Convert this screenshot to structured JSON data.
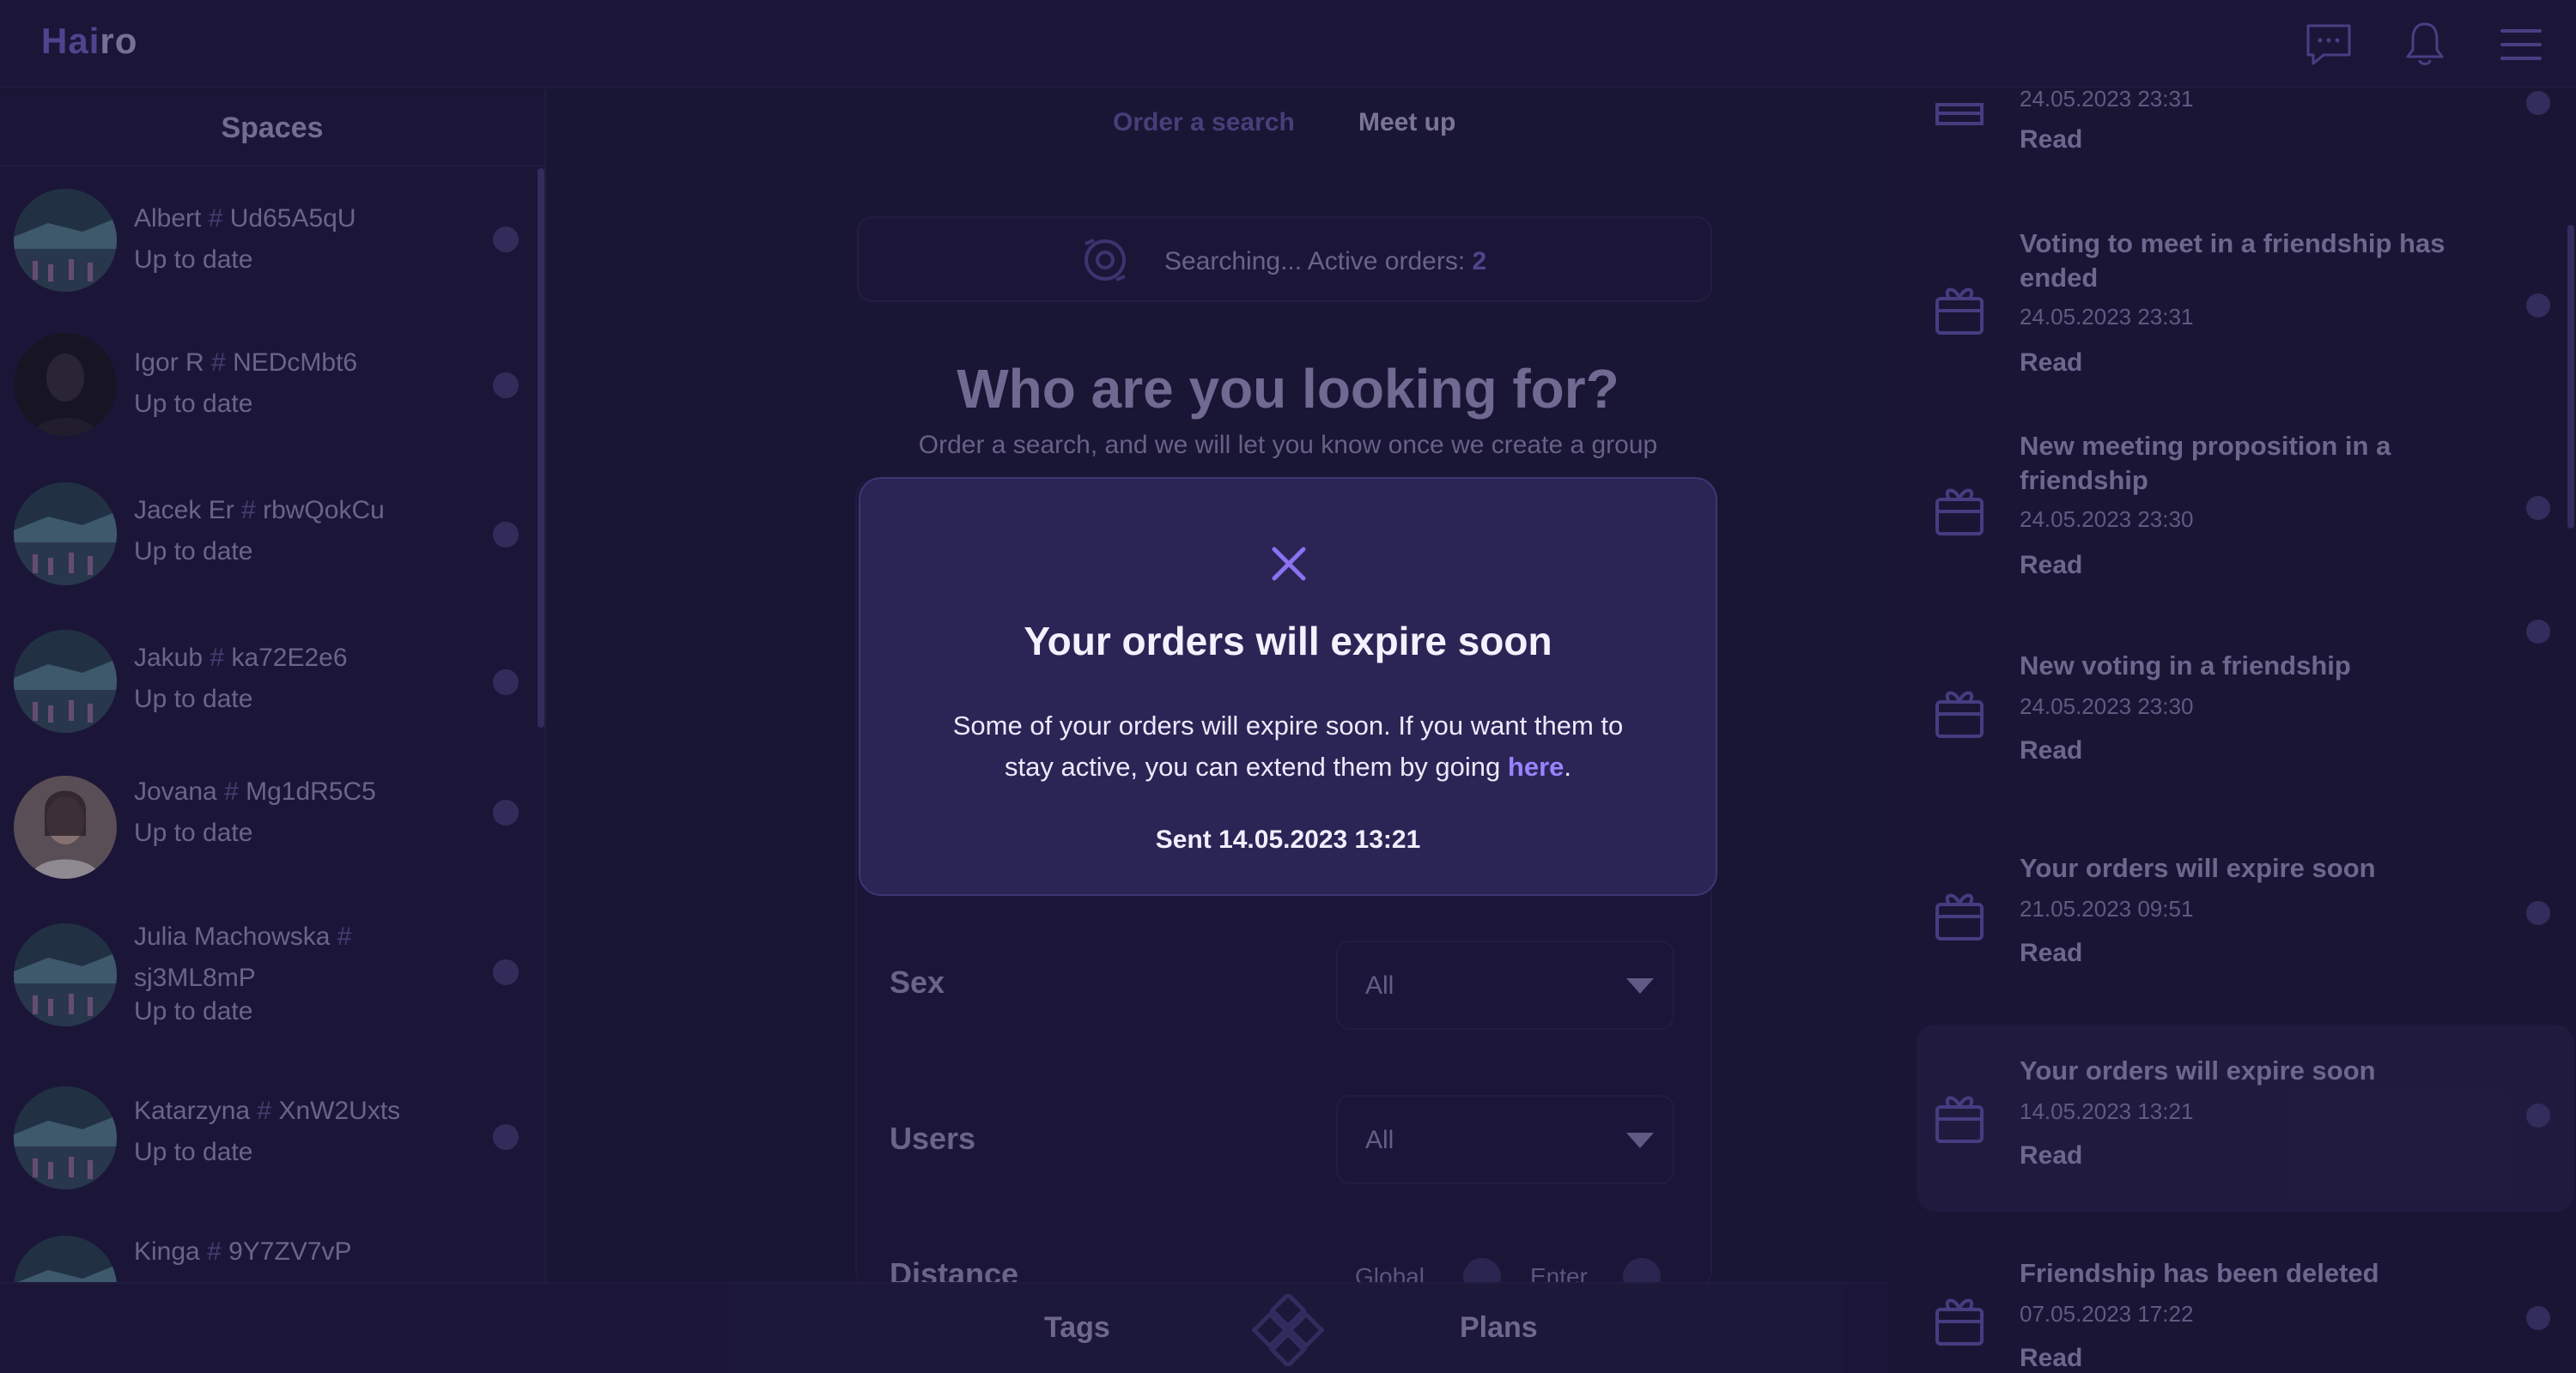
{
  "app": {
    "logo_a": "Hai",
    "logo_b": "ro"
  },
  "header": {
    "chat_icon": "chat-bubble-icon",
    "bell_icon": "bell-icon",
    "menu_icon": "hamburger-menu-icon"
  },
  "sidebar": {
    "title": "Spaces",
    "items": [
      {
        "name": "Albert",
        "hash": "#",
        "code": "Ud65A5qU",
        "status": "Up to date"
      },
      {
        "name": "Igor R",
        "hash": "#",
        "code": "NEDcMbt6",
        "status": "Up to date"
      },
      {
        "name": "Jacek Er",
        "hash": "#",
        "code": "rbwQokCu",
        "status": "Up to date"
      },
      {
        "name": "Jakub",
        "hash": "#",
        "code": "ka72E2e6",
        "status": "Up to date"
      },
      {
        "name": "Jovana",
        "hash": "#",
        "code": "Mg1dR5C5",
        "status": "Up to date"
      },
      {
        "name": "Julia Machowska",
        "hash": "#",
        "code": "sj3ML8mP",
        "status": "Up to date"
      },
      {
        "name": "Katarzyna",
        "hash": "#",
        "code": "XnW2Uxts",
        "status": "Up to date"
      },
      {
        "name": "Kinga",
        "hash": "#",
        "code": "9Y7ZV7vP",
        "status": ""
      }
    ]
  },
  "center": {
    "tabs": [
      {
        "label": "Order a search"
      },
      {
        "label": "Meet up"
      }
    ],
    "searching_label": "Searching... Active orders:",
    "active_orders": "2",
    "title": "Who are you looking for?",
    "subtitle": "Order a search, and we will let you know once we create a group",
    "fields": {
      "sex": {
        "label": "Sex",
        "value": "All"
      },
      "users": {
        "label": "Users",
        "value": "All"
      },
      "distance": {
        "label": "Distance",
        "option_global": "Global",
        "option_enter": "Enter"
      }
    }
  },
  "bottom_nav": {
    "tags": "Tags",
    "plans": "Plans"
  },
  "notifications": [
    {
      "title": "",
      "date": "24.05.2023 23:31",
      "read": "Read"
    },
    {
      "title": "Voting to meet in a friendship has ended",
      "date": "24.05.2023 23:31",
      "read": "Read"
    },
    {
      "title": "New meeting proposition in a friendship",
      "date": "24.05.2023 23:30",
      "read": "Read"
    },
    {
      "title": "New voting in a friendship",
      "date": "24.05.2023 23:30",
      "read": "Read"
    },
    {
      "title": "Your orders will expire soon",
      "date": "21.05.2023 09:51",
      "read": "Read"
    },
    {
      "title": "Your orders will expire soon",
      "date": "14.05.2023 13:21",
      "read": "Read"
    },
    {
      "title": "Friendship has been deleted",
      "date": "07.05.2023 17:22",
      "read": "Read"
    }
  ],
  "modal": {
    "title": "Your orders will expire soon",
    "body": "Some of your orders will expire soon. If you want them to stay active, you can extend them by going",
    "link": "here",
    "period": ".",
    "sent": "Sent 14.05.2023 13:21"
  },
  "colors": {
    "background": "#1e1a3d",
    "accent": "#7c6cd8",
    "modal": "#2b2556",
    "link": "#9a82ff"
  }
}
